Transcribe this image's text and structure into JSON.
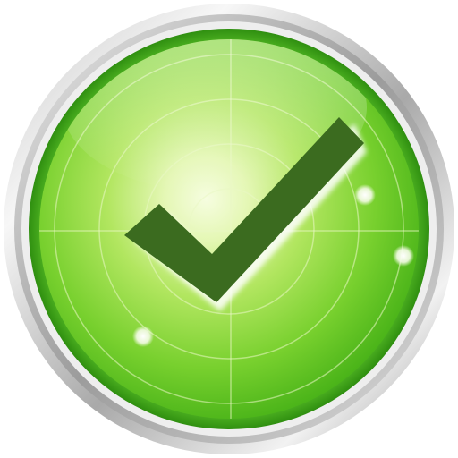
{
  "icon": {
    "name": "checkmark-radar-badge",
    "shape": "circle",
    "symbol": "check-mark"
  },
  "colors": {
    "background": "#ffffff",
    "bezel_light": "#f2f2f2",
    "bezel_mid": "#c9c9c9",
    "bezel_dark": "#8f8f8f",
    "inner_rim": "#2f9e12",
    "face_bright": "#eef9c8",
    "face_mid": "#8fdc3a",
    "face_dark": "#3fae14",
    "grid_lines": "#e9f7c0",
    "check_fill": "#3b6b1f",
    "check_shadow": "#ffffff",
    "blip": "#f4fbe6"
  }
}
